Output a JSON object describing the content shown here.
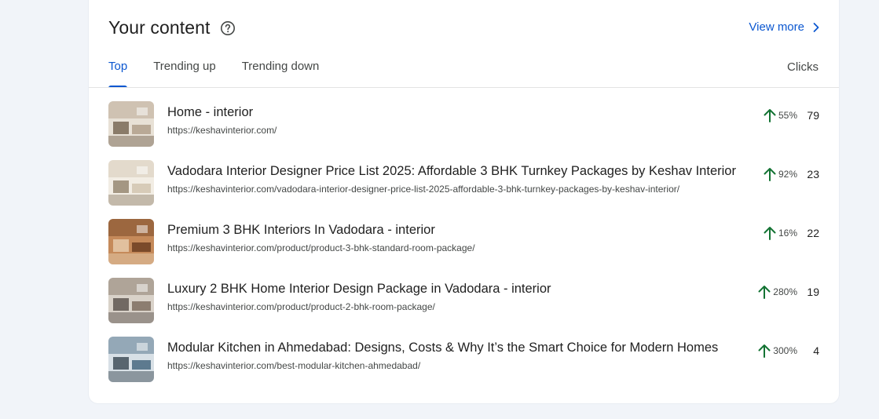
{
  "header": {
    "title": "Your content",
    "help_icon": "help-circle-icon",
    "view_more": "View more"
  },
  "tabs": [
    {
      "label": "Top",
      "active": true
    },
    {
      "label": "Trending up",
      "active": false
    },
    {
      "label": "Trending down",
      "active": false
    }
  ],
  "column_label": "Clicks",
  "colors": {
    "accent": "#0b57d0",
    "trend_up": "#137333",
    "background": "#f1f4f9"
  },
  "rows": [
    {
      "title": "Home - interior",
      "url": "https://keshavinterior.com/",
      "change": "55%",
      "clicks": "79",
      "thumb_colors": [
        "#b9a996",
        "#e8e1d6",
        "#6b5844"
      ]
    },
    {
      "title": "Vadodara Interior Designer Price List 2025: Affordable 3 BHK Turnkey Packages by Keshav Interior",
      "url": "https://keshavinterior.com/vadodara-interior-designer-price-list-2025-affordable-3-bhk-turnkey-packages-by-keshav-interior/",
      "change": "92%",
      "clicks": "23",
      "thumb_colors": [
        "#d7cbb8",
        "#f2ede4",
        "#8a7a63"
      ]
    },
    {
      "title": "Premium 3 BHK Interiors In Vadodara - interior",
      "url": "https://keshavinterior.com/product/product-3-bhk-standard-room-package/",
      "change": "16%",
      "clicks": "22",
      "thumb_colors": [
        "#7a4a2a",
        "#c58a5a",
        "#e9d2b5"
      ]
    },
    {
      "title": "Luxury 2 BHK Home Interior Design Package in Vadodara - interior",
      "url": "https://keshavinterior.com/product/product-2-bhk-room-package/",
      "change": "280%",
      "clicks": "19",
      "thumb_colors": [
        "#8c7d70",
        "#d9d2c9",
        "#4e4540"
      ]
    },
    {
      "title": "Modular Kitchen in Ahmedabad: Designs, Costs & Why It’s the Smart Choice for Modern Homes",
      "url": "https://keshavinterior.com/best-modular-kitchen-ahmedabad/",
      "change": "300%",
      "clicks": "4",
      "thumb_colors": [
        "#5d7a8f",
        "#d8e0e6",
        "#2e3c47"
      ]
    }
  ]
}
